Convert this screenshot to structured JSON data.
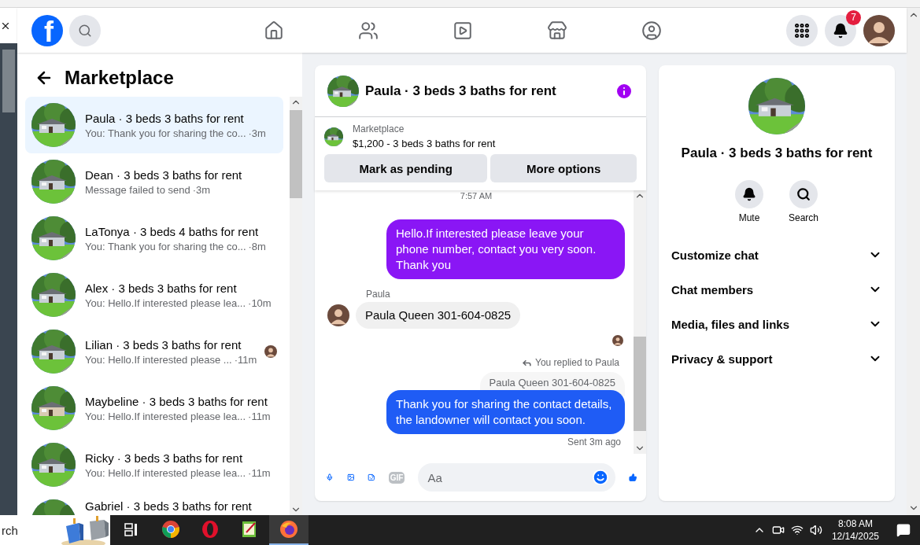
{
  "nav": {
    "logo_text": "f",
    "notification_count": "7"
  },
  "conversations": {
    "title": "Marketplace",
    "items": [
      {
        "name": "Paula · 3 beds 3 baths for rent",
        "preview": "You: Thank you for sharing the co...",
        "time": "·3m",
        "selected": true,
        "seen": false
      },
      {
        "name": "Dean · 3 beds 3 baths for rent",
        "preview": "Message failed to send",
        "time": "·3m",
        "selected": false,
        "seen": false
      },
      {
        "name": "LaTonya · 3 beds 4 baths for rent",
        "preview": "You: Thank you for sharing the co...",
        "time": "·8m",
        "selected": false,
        "seen": false
      },
      {
        "name": "Alex · 3 beds 3 baths for rent",
        "preview": "You: Hello.If interested please lea...",
        "time": "·10m",
        "selected": false,
        "seen": false
      },
      {
        "name": "Lilian · 3 beds 3 baths for rent",
        "preview": "You: Hello.If interested please ...",
        "time": "·11m",
        "selected": false,
        "seen": true
      },
      {
        "name": "Maybeline · 3 beds 3 baths for rent",
        "preview": "You: Hello.If interested please lea...",
        "time": "·11m",
        "selected": false,
        "seen": false
      },
      {
        "name": "Ricky · 3 beds 3 baths for rent",
        "preview": "You: Hello.If interested please lea...",
        "time": "·11m",
        "selected": false,
        "seen": false
      },
      {
        "name": "Gabriel · 3 beds 3 baths for rent",
        "selected": false,
        "seen": false
      }
    ]
  },
  "chat": {
    "title": "Paula · 3 beds 3 baths for rent",
    "listing": {
      "label": "Marketplace",
      "title": "$1,200 - 3 beds 3 baths for rent"
    },
    "actions": [
      "Mark as pending",
      "More options"
    ],
    "messages": [
      {
        "kind": "timestamp",
        "text": "7:57 AM"
      },
      {
        "kind": "sent",
        "text": "Hello.If interested please leave your phone number, contact you very soon. Thank you",
        "color": "#8a16f5"
      },
      {
        "kind": "sender",
        "text": "Paula"
      },
      {
        "kind": "received",
        "text": "Paula Queen 301-604-0825"
      },
      {
        "kind": "read_receipt"
      },
      {
        "kind": "reply_note",
        "text": "You replied to Paula"
      },
      {
        "kind": "quote",
        "text": "Paula Queen 301-604-0825"
      },
      {
        "kind": "sent",
        "text": "Thank you for sharing the contact details, the landowner will contact you soon.",
        "color": "#1f5cf5"
      },
      {
        "kind": "status",
        "text": "Sent 3m ago"
      }
    ],
    "composer": {
      "placeholder": "Aa",
      "gif_label": "GIF"
    }
  },
  "info": {
    "title": "Paula · 3 beds 3 baths for rent",
    "actions": [
      {
        "kind": "mute",
        "label": "Mute"
      },
      {
        "kind": "search",
        "label": "Search"
      }
    ],
    "sections": [
      {
        "label": "Customize chat",
        "expanded": false
      },
      {
        "label": "Chat members",
        "expanded": false
      },
      {
        "label": "Media, files and links",
        "expanded": false
      },
      {
        "label": "Privacy & support",
        "expanded": false
      }
    ]
  },
  "taskbar": {
    "search_text": "rch",
    "apps": [
      {
        "kind": "task_view",
        "selected": false
      },
      {
        "kind": "chrome",
        "selected": false
      },
      {
        "kind": "opera",
        "selected": false
      },
      {
        "kind": "notepad",
        "selected": false
      },
      {
        "kind": "firefox",
        "selected": true
      }
    ],
    "time": "8:08 AM",
    "date": "12/14/2025"
  }
}
